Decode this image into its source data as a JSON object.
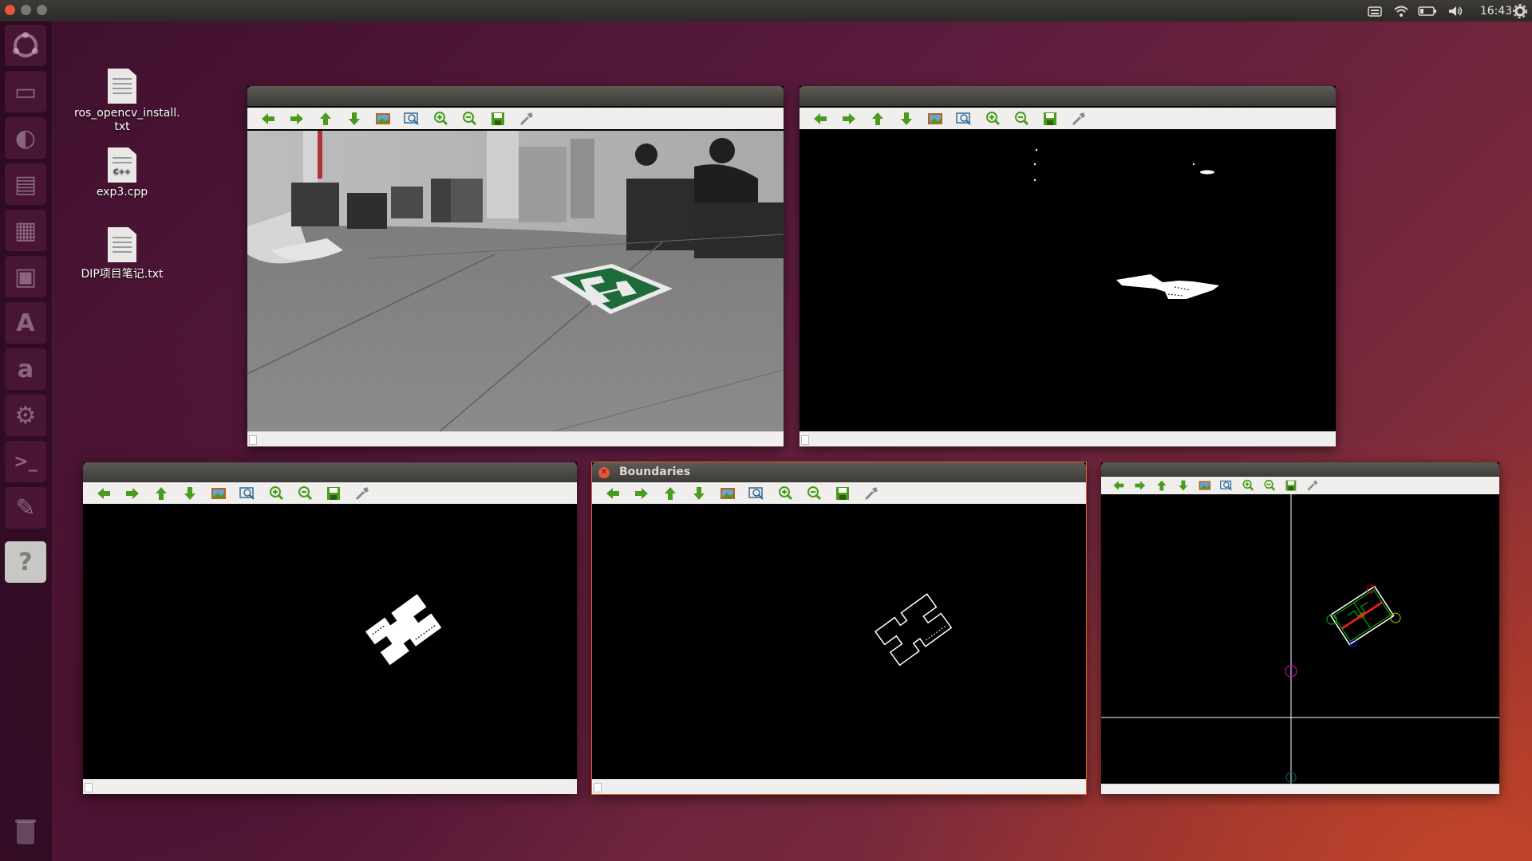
{
  "top_panel": {
    "clock": "16:43",
    "tray_icons": [
      "keyboard-icon",
      "wifi-icon",
      "battery-icon",
      "volume-icon",
      "gear-icon"
    ]
  },
  "launcher": {
    "items": [
      "ubuntu-icon",
      "files-icon",
      "firefox-icon",
      "writer-icon",
      "calc-icon",
      "impress-icon",
      "software-center-icon",
      "amazon-icon",
      "settings-icon",
      "terminal-icon",
      "text-editor-icon",
      "help-icon",
      "trash-icon"
    ]
  },
  "desktop": {
    "icons": [
      {
        "label": "ros_opencv_install.\ntxt",
        "type": "txt"
      },
      {
        "label": "exp3.cpp",
        "type": "cpp"
      },
      {
        "label": "DIP项目笔记.txt",
        "type": "txt"
      }
    ]
  },
  "toolbar_icons": [
    "pan-left-icon",
    "pan-right-icon",
    "pan-up-icon",
    "pan-down-icon",
    "zoom-original-icon",
    "zoom-fit-icon",
    "zoom-in-icon",
    "zoom-out-icon",
    "save-icon",
    "properties-icon"
  ],
  "windows": [
    {
      "id": "camera",
      "title": ""
    },
    {
      "id": "threshold",
      "title": ""
    },
    {
      "id": "filled",
      "title": ""
    },
    {
      "id": "boundaries",
      "title": "Boundaries"
    },
    {
      "id": "geometry",
      "title": ""
    }
  ],
  "colors": {
    "accent": "#e5612f",
    "toolbar_green": "#4a9b1e",
    "target_green": "#1d6b3a"
  }
}
